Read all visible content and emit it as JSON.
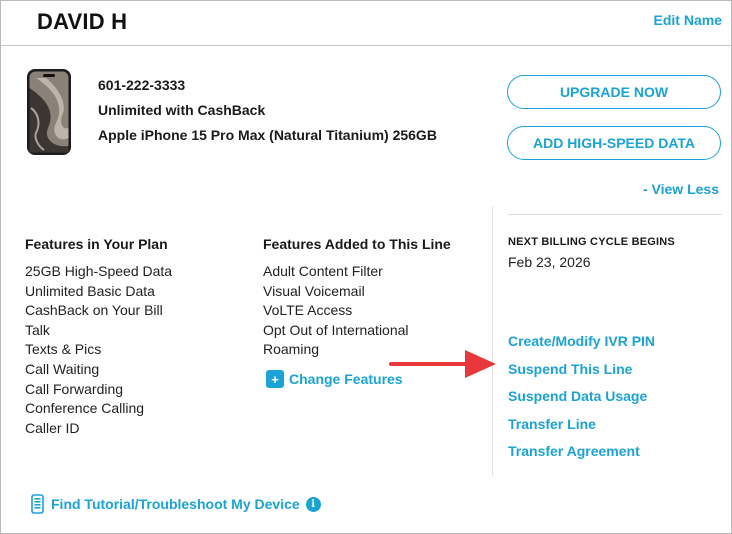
{
  "header": {
    "name": "DAVID H",
    "edit_label": "Edit Name"
  },
  "line": {
    "phone_number": "601-222-3333",
    "plan": "Unlimited with CashBack",
    "device": "Apple iPhone 15 Pro Max (Natural Titanium) 256GB"
  },
  "actions": {
    "upgrade_label": "UPGRADE NOW",
    "add_data_label": "ADD HIGH-SPEED DATA",
    "view_less_label": "- View Less"
  },
  "plan_features": {
    "heading": "Features in Your Plan",
    "items": [
      "25GB High-Speed Data",
      "Unlimited Basic Data",
      "CashBack on Your Bill",
      "Talk",
      "Texts & Pics",
      "Call Waiting",
      "Call Forwarding",
      "Conference Calling",
      "Caller ID"
    ]
  },
  "added_features": {
    "heading": "Features Added to This Line",
    "items": [
      "Adult Content Filter",
      "Visual Voicemail",
      "VoLTE Access",
      "Opt Out of International",
      "Roaming"
    ],
    "change_label": "Change Features"
  },
  "billing": {
    "label": "NEXT BILLING CYCLE BEGINS",
    "date": "Feb 23, 2026"
  },
  "links": [
    "Create/Modify IVR PIN",
    "Suspend This Line",
    "Suspend Data Usage",
    "Transfer Line",
    "Transfer Agreement"
  ],
  "footer": {
    "tutorial_label": "Find Tutorial/Troubleshoot My Device"
  },
  "colors": {
    "accent": "#1aa3d6",
    "annotation_arrow": "#e8383b"
  },
  "icons": {
    "phone": "phone-image",
    "plus": "plus-icon",
    "device": "device-icon",
    "info": "info-icon",
    "arrow": "red-arrow-annotation"
  }
}
